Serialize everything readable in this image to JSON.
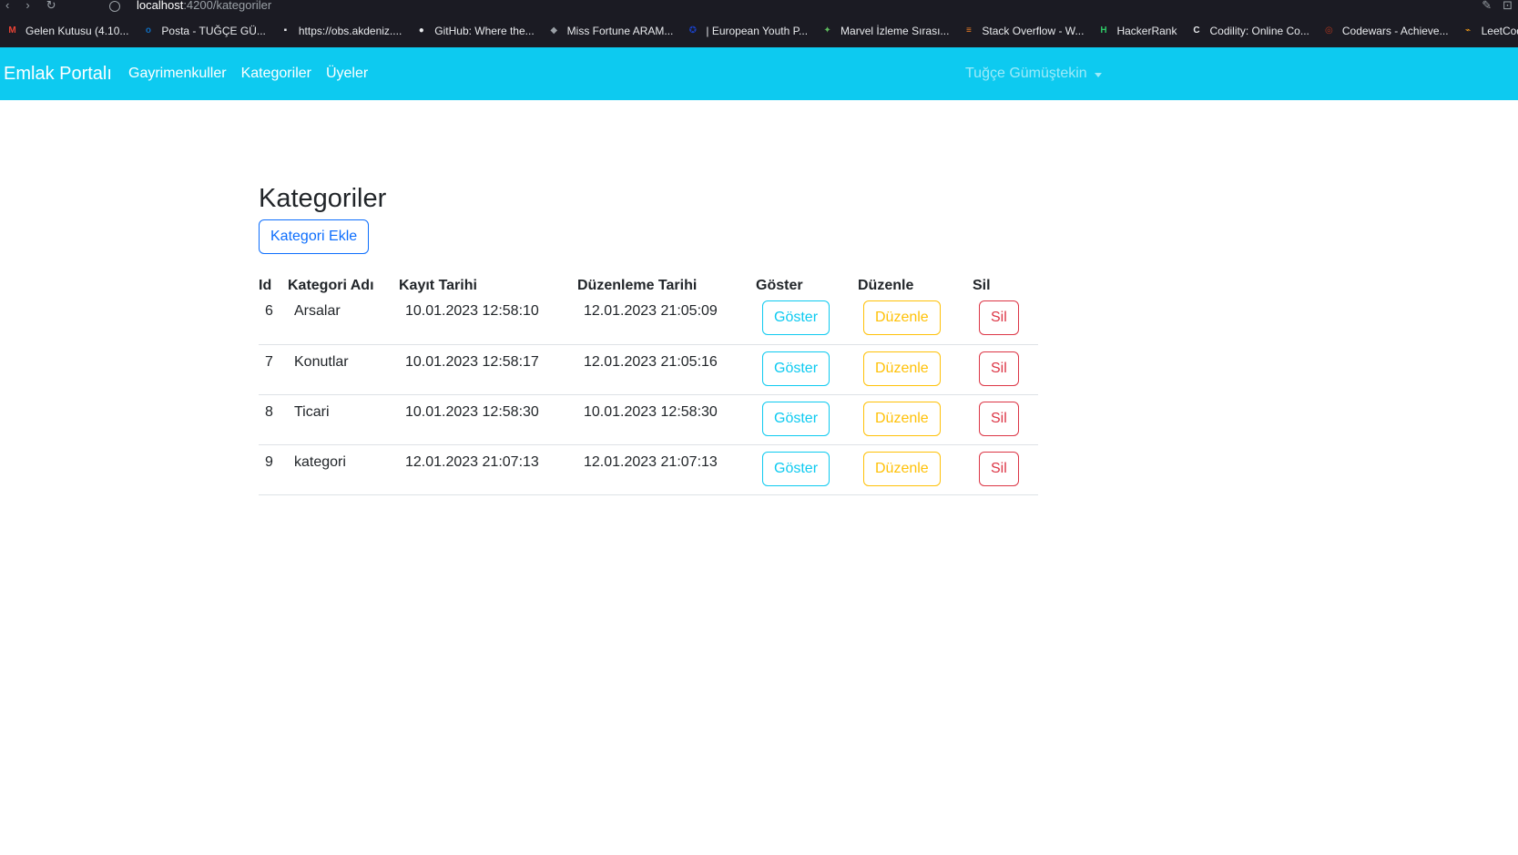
{
  "browser": {
    "url_host": "localhost",
    "url_path": ":4200/kategoriler",
    "bookmarks": [
      {
        "icon": "gmail-icon",
        "label": "Gelen Kutusu (4.10...",
        "color": "#ea4335",
        "glyph": "M"
      },
      {
        "icon": "outlook-icon",
        "label": "Posta - TUĞÇE GÜ...",
        "color": "#0f6cbd",
        "glyph": "o"
      },
      {
        "icon": "file-icon",
        "label": "https://obs.akdeniz....",
        "color": "#e8eaed",
        "glyph": "▪"
      },
      {
        "icon": "github-icon",
        "label": "GitHub: Where the...",
        "color": "#e8eaed",
        "glyph": "●"
      },
      {
        "icon": "game-icon",
        "label": "Miss Fortune ARAM...",
        "color": "#9aa0a6",
        "glyph": "◆"
      },
      {
        "icon": "eu-flag-icon",
        "label": "| European Youth P...",
        "color": "#1a3fbf",
        "glyph": "✪"
      },
      {
        "icon": "marvel-icon",
        "label": "Marvel İzleme Sırası...",
        "color": "#5cb85c",
        "glyph": "✦"
      },
      {
        "icon": "stackoverflow-icon",
        "label": "Stack Overflow - W...",
        "color": "#f48024",
        "glyph": "≡"
      },
      {
        "icon": "hackerrank-icon",
        "label": "HackerRank",
        "color": "#2ec866",
        "glyph": "H"
      },
      {
        "icon": "codility-icon",
        "label": "Codility: Online Co...",
        "color": "#e8eaed",
        "glyph": "C"
      },
      {
        "icon": "codewars-icon",
        "label": "Codewars - Achieve...",
        "color": "#b1361e",
        "glyph": "◎"
      },
      {
        "icon": "leetcode-icon",
        "label": "LeetCode - The Wo...",
        "color": "#ffa116",
        "glyph": "⌁"
      }
    ]
  },
  "navbar": {
    "brand": "Emlak Portalı",
    "links": [
      "Gayrimenkuller",
      "Kategoriler",
      "Üyeler"
    ],
    "user": "Tuğçe Gümüştekin",
    "bg_color": "#0dcaf0"
  },
  "main": {
    "title": "Kategoriler",
    "add_button": "Kategori Ekle",
    "columns": [
      "Id",
      "Kategori Adı",
      "Kayıt Tarihi",
      "Düzenleme Tarihi",
      "Göster",
      "Düzenle",
      "Sil"
    ],
    "rows": [
      {
        "id": "6",
        "name": "Arsalar",
        "created": "10.01.2023 12:58:10",
        "updated": "12.01.2023 21:05:09",
        "show": "Göster",
        "edit": "Düzenle",
        "delete": "Sil"
      },
      {
        "id": "7",
        "name": "Konutlar",
        "created": "10.01.2023 12:58:17",
        "updated": "12.01.2023 21:05:16",
        "show": "Göster",
        "edit": "Düzenle",
        "delete": "Sil"
      },
      {
        "id": "8",
        "name": "Ticari",
        "created": "10.01.2023 12:58:30",
        "updated": "10.01.2023 12:58:30",
        "show": "Göster",
        "edit": "Düzenle",
        "delete": "Sil"
      },
      {
        "id": "9",
        "name": "kategori",
        "created": "12.01.2023 21:07:13",
        "updated": "12.01.2023 21:07:13",
        "show": "Göster",
        "edit": "Düzenle",
        "delete": "Sil"
      }
    ]
  },
  "colors": {
    "info": "#0dcaf0",
    "primary": "#0d6efd",
    "warning": "#ffc107",
    "danger": "#dc3545"
  }
}
